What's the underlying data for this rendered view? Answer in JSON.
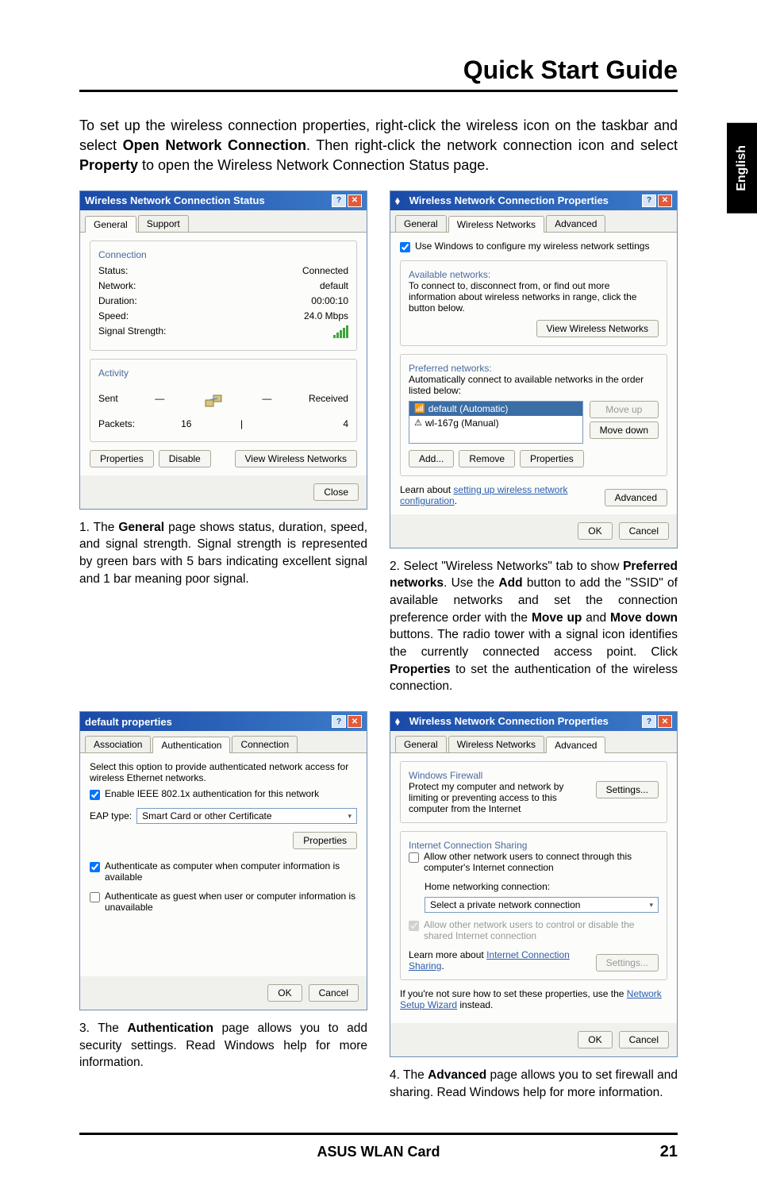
{
  "sideTab": "English",
  "header": "Quick Start Guide",
  "intro": {
    "pre": "To set up the wireless connection properties, right-click the wireless icon on the taskbar and select ",
    "bold1": "Open Network Connection",
    "mid1": ". Then right-click the network connection icon and select ",
    "bold2": "Property",
    "post": " to open the Wireless Network Connection Status page."
  },
  "dlgStatus": {
    "title": "Wireless Network Connection Status",
    "tabs": {
      "general": "General",
      "support": "Support"
    },
    "connection": {
      "legend": "Connection",
      "statusLabel": "Status:",
      "statusValue": "Connected",
      "networkLabel": "Network:",
      "networkValue": "default",
      "durationLabel": "Duration:",
      "durationValue": "00:00:10",
      "speedLabel": "Speed:",
      "speedValue": "24.0 Mbps",
      "signalLabel": "Signal Strength:"
    },
    "activity": {
      "legend": "Activity",
      "sent": "Sent",
      "received": "Received",
      "packetsLabel": "Packets:",
      "sentVal": "16",
      "recvVal": "4"
    },
    "buttons": {
      "properties": "Properties",
      "disable": "Disable",
      "viewNetworks": "View Wireless Networks",
      "close": "Close"
    }
  },
  "dlgProps": {
    "title": "Wireless Network Connection Properties",
    "tabs": {
      "general": "General",
      "wireless": "Wireless Networks",
      "advanced": "Advanced"
    },
    "useWindows": "Use Windows to configure my wireless network settings",
    "available": {
      "legend": "Available networks:",
      "desc": "To connect to, disconnect from, or find out more information about wireless networks in range, click the button below.",
      "button": "View Wireless Networks"
    },
    "preferred": {
      "legend": "Preferred networks:",
      "desc": "Automatically connect to available networks in the order listed below:",
      "items": [
        "default (Automatic)",
        "wl-167g (Manual)"
      ],
      "moveUp": "Move up",
      "moveDown": "Move down",
      "add": "Add...",
      "remove": "Remove",
      "propertiesBtn": "Properties"
    },
    "learnPre": "Learn about ",
    "learnLink": "setting up wireless network configuration",
    "learnPost": ".",
    "advancedBtn": "Advanced",
    "ok": "OK",
    "cancel": "Cancel"
  },
  "dlgDefault": {
    "title": "default properties",
    "tabs": {
      "association": "Association",
      "authentication": "Authentication",
      "connection": "Connection"
    },
    "desc": "Select this option to provide authenticated network access for wireless Ethernet networks.",
    "enable": "Enable IEEE 802.1x authentication for this network",
    "eapLabel": "EAP type:",
    "eapValue": "Smart Card or other Certificate",
    "propertiesBtn": "Properties",
    "authComputer": "Authenticate as computer when computer information is available",
    "authGuest": "Authenticate as guest when user or computer information is unavailable",
    "ok": "OK",
    "cancel": "Cancel"
  },
  "dlgAdvanced": {
    "title": "Wireless Network Connection Properties",
    "tabs": {
      "general": "General",
      "wireless": "Wireless Networks",
      "advanced": "Advanced"
    },
    "firewall": {
      "legend": "Windows Firewall",
      "desc": "Protect my computer and network by limiting or preventing access to this computer from the Internet",
      "settings": "Settings..."
    },
    "ics": {
      "legend": "Internet Connection Sharing",
      "allowOthers": "Allow other network users to connect through this computer's Internet connection",
      "homeLabel": "Home networking connection:",
      "homeValue": "Select a private network connection",
      "allowControl": "Allow other network users to control or disable the shared Internet connection",
      "learnPre": "Learn more about ",
      "learnLink": "Internet Connection Sharing",
      "learnPost": ".",
      "settings": "Settings..."
    },
    "wizardPre": "If you're not sure how to set these properties, use the ",
    "wizardLink": "Network Setup Wizard",
    "wizardPost": " instead.",
    "ok": "OK",
    "cancel": "Cancel"
  },
  "captions": {
    "c1": {
      "num": "1. The ",
      "b1": "General",
      "rest": " page shows status, duration, speed, and signal strength. Signal strength is represented by green bars with 5 bars indicating excellent signal and 1 bar meaning poor signal."
    },
    "c2": {
      "num": "2. Select \"Wireless Networks\" tab to show ",
      "b1": "Preferred networks",
      "t1": ". Use the ",
      "b2": "Add",
      "t2": " button to add the \"SSID\" of available networks and set the connection preference order with the ",
      "b3": "Move up",
      "t3": " and ",
      "b4": "Move down",
      "t4": " buttons. The radio tower with a signal icon identifies the currently connected access point. Click ",
      "b5": "Properties",
      "t5": " to set the authentication of the wireless connection."
    },
    "c3": {
      "num": "3. The ",
      "b1": "Authentication",
      "rest": " page allows you to add security settings. Read Windows help for more information."
    },
    "c4": {
      "num": "4. The ",
      "b1": "Advanced",
      "rest": " page allows you to set firewall and sharing. Read Windows help for more information."
    }
  },
  "footer": {
    "center": "ASUS WLAN Card",
    "page": "21"
  }
}
